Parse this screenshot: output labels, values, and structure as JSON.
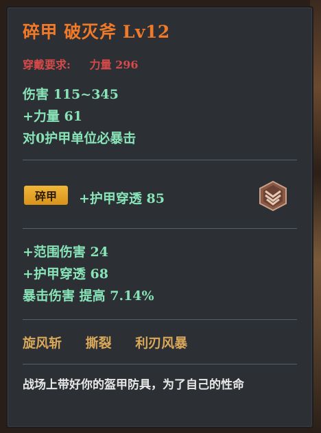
{
  "tooltip": {
    "title": "碎甲  破灭斧  Lv12",
    "requirement": {
      "label": "穿戴要求:",
      "value": "力量  296"
    },
    "base_stats": [
      "伤害   115~345",
      "+力量  61",
      "对0护甲单位必暴击"
    ],
    "set": {
      "badge": "碎甲",
      "bonus": "+护甲穿透  85"
    },
    "extra_stats": [
      "+范围伤害  24",
      "+护甲穿透  68",
      "暴击伤害  提高  7.14%"
    ],
    "skills": [
      "旋风斩",
      "撕裂",
      "利刃风暴"
    ],
    "flavor_text": "战场上带好你的盔甲防具，为了自己的性命"
  },
  "colors": {
    "title": "#f07a2a",
    "requirement": "#d64a4a",
    "stat": "#88e4b8",
    "skill": "#d9a85a",
    "badge": "#e8a52a"
  },
  "icons": {
    "set_emblem": "shield-chevron-emblem-icon"
  }
}
